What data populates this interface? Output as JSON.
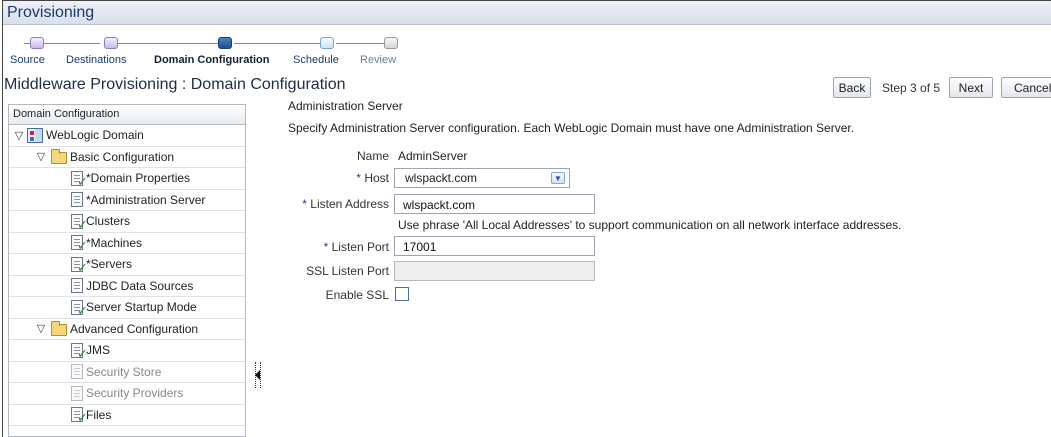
{
  "window": {
    "title": "Provisioning"
  },
  "train": {
    "steps": [
      {
        "label": "Source",
        "state": "done"
      },
      {
        "label": "Destinations",
        "state": "done"
      },
      {
        "label": "Domain Configuration",
        "state": "current"
      },
      {
        "label": "Schedule",
        "state": "future"
      },
      {
        "label": "Review",
        "state": "last"
      }
    ]
  },
  "page": {
    "heading": "Middleware Provisioning : Domain Configuration"
  },
  "nav": {
    "back_label": "Back",
    "step_text": "Step 3 of 5",
    "next_label": "Next",
    "cancel_label": "Cancel"
  },
  "tree": {
    "header": "Domain Configuration",
    "items": [
      {
        "label": "WebLogic Domain",
        "icon": "domain-icon",
        "toggle": "▽"
      },
      {
        "label": "Basic Configuration",
        "icon": "folder-icon",
        "toggle": "▽"
      },
      {
        "label": "*Domain Properties",
        "icon": "page-checked-icon"
      },
      {
        "label": "*Administration Server",
        "icon": "page-icon"
      },
      {
        "label": "Clusters",
        "icon": "page-checked-icon"
      },
      {
        "label": "*Machines",
        "icon": "page-checked-icon"
      },
      {
        "label": "*Servers",
        "icon": "page-checked-icon"
      },
      {
        "label": "JDBC Data Sources",
        "icon": "page-icon"
      },
      {
        "label": "Server Startup Mode",
        "icon": "page-checked-icon"
      },
      {
        "label": "Advanced Configuration",
        "icon": "folder-icon",
        "toggle": "▽"
      },
      {
        "label": "JMS",
        "icon": "page-checked-icon"
      },
      {
        "label": "Security Store",
        "icon": "page-faded-icon"
      },
      {
        "label": "Security Providers",
        "icon": "page-faded-icon"
      },
      {
        "label": "Files",
        "icon": "page-checked-icon"
      }
    ]
  },
  "form": {
    "section_title": "Administration Server",
    "description": "Specify Administration Server configuration. Each WebLogic Domain must have one Administration Server.",
    "name_label": "Name",
    "name_value": "AdminServer",
    "host_label": "Host",
    "host_value": "wlspackt.com",
    "listen_address_label": "Listen Address",
    "listen_address_value": "wlspackt.com",
    "listen_address_hint": "Use phrase 'All Local Addresses' to support communication on all network interface addresses.",
    "listen_port_label": "Listen Port",
    "listen_port_value": "17001",
    "ssl_listen_port_label": "SSL Listen Port",
    "ssl_listen_port_value": "",
    "enable_ssl_label": "Enable SSL",
    "enable_ssl_checked": false,
    "required_marker": "*"
  }
}
